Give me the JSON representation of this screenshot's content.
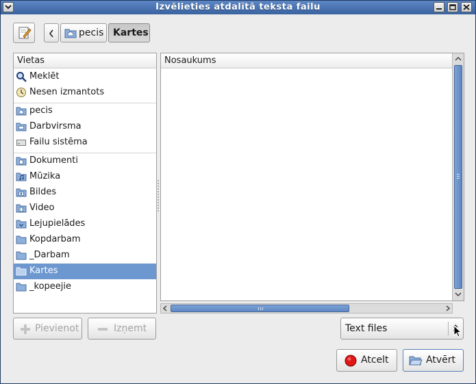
{
  "window": {
    "title": "Izvēlieties atdalītā teksta failu"
  },
  "toolbar": {
    "edit_icon": "pencil-paper-icon",
    "back_icon": "chevron-left-icon",
    "path": [
      {
        "label": "pecis",
        "icon": "home-folder-icon",
        "active": false
      },
      {
        "label": "Kartes",
        "icon": "",
        "active": true
      }
    ]
  },
  "places": {
    "header": "Vietas",
    "groups": [
      [
        {
          "label": "Meklēt",
          "icon": "search-icon"
        },
        {
          "label": "Nesen izmantots",
          "icon": "clock-icon"
        }
      ],
      [
        {
          "label": "pecis",
          "icon": "home-folder-icon"
        },
        {
          "label": "Darbvirsma",
          "icon": "desktop-folder-icon"
        },
        {
          "label": "Failu sistēma",
          "icon": "drive-icon"
        }
      ],
      [
        {
          "label": "Dokumenti",
          "icon": "documents-folder-icon"
        },
        {
          "label": "Mūzika",
          "icon": "music-folder-icon"
        },
        {
          "label": "Bildes",
          "icon": "pictures-folder-icon"
        },
        {
          "label": "Video",
          "icon": "video-folder-icon"
        },
        {
          "label": "Lejupielādes",
          "icon": "downloads-folder-icon"
        },
        {
          "label": "Kopdarbam",
          "icon": "folder-icon"
        },
        {
          "label": "_Darbam",
          "icon": "folder-icon"
        },
        {
          "label": "Kartes",
          "icon": "folder-icon",
          "selected": true
        },
        {
          "label": "_kopeejie",
          "icon": "folder-icon"
        }
      ]
    ],
    "add_label": "Pievienot",
    "remove_label": "Izņemt"
  },
  "files": {
    "header": "Nosaukums"
  },
  "filter": {
    "selected": "Text files"
  },
  "actions": {
    "cancel_label": "Atcelt",
    "open_label": "Atvērt"
  },
  "colors": {
    "titlebar": "#4a73b2",
    "selection": "#6d97cf",
    "window_bg": "#ececec"
  }
}
